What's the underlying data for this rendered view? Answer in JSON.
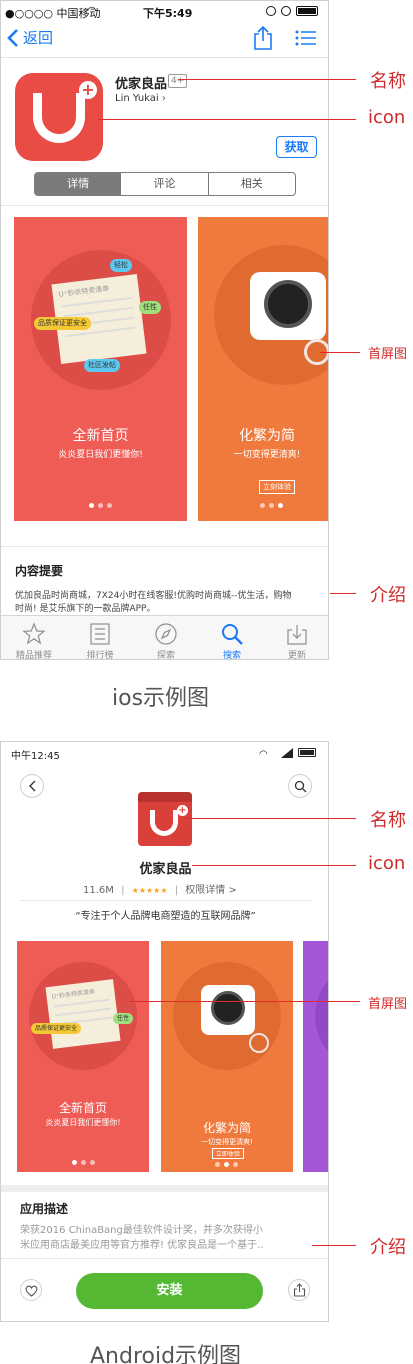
{
  "ios": {
    "status": {
      "carrier": "●○○○○ 中国移动",
      "time": "下午5:49"
    },
    "nav": {
      "back_label": "返回"
    },
    "app": {
      "name": "优家良品",
      "age_rating": "4+",
      "developer": "Lin Yukai",
      "get_label": "获取",
      "icon_letter": "U"
    },
    "segments": [
      "详情",
      "评论",
      "相关"
    ],
    "screenshots": [
      {
        "title": "全新首页",
        "subtitle": "炎炎夏日我们更懂你!",
        "paper_title": "U⁺秒杀特卖清单",
        "chips": [
          "轻松",
          "任性",
          "品质保证更安全",
          "社区发帖"
        ]
      },
      {
        "title": "化繁为简",
        "subtitle": "一切变得更清爽!",
        "button": "立刻体验"
      }
    ],
    "desc": {
      "heading": "内容提要",
      "text1": "优加良品时尚商城，7X24小时在线客服!优购时尚商城--优生活，购物",
      "text2": "时尚! 是艾乐旗下的一款品牌APP。"
    },
    "tabs": [
      {
        "label": "精品推荐",
        "icon": "star-icon"
      },
      {
        "label": "排行榜",
        "icon": "list-icon"
      },
      {
        "label": "探索",
        "icon": "compass-icon"
      },
      {
        "label": "搜索",
        "icon": "search-icon"
      },
      {
        "label": "更新",
        "icon": "download-icon"
      }
    ],
    "active_tab_index": 3
  },
  "android": {
    "status": {
      "time": "中午12:45"
    },
    "app": {
      "name": "优家良品",
      "size": "11.6M",
      "stars": "★★★★★",
      "permissions": "权限详情 >",
      "slogan": "“专注于个人品牌电商塑造的互联网品牌”",
      "icon_letter": "U"
    },
    "screenshots": [
      {
        "title": "全新首页",
        "subtitle": "炎炎夏日我们更懂你!",
        "paper_title": "U⁺秒杀特卖清单",
        "chips": [
          "任性",
          "品质保证更安全"
        ]
      },
      {
        "title": "化繁为简",
        "subtitle": "一切变得更清爽!",
        "button": "立即体验"
      }
    ],
    "desc": {
      "heading": "应用描述",
      "text1": "荣获2016 ChinaBang最佳软件设计奖，并多次获得小",
      "text2": "米应用商店最美应用等官方推荐! 优家良品是一个基于.."
    },
    "install_label": "安装"
  },
  "annotations": {
    "name": "名称",
    "icon": "icon",
    "screenshot": "首屏图",
    "intro": "介绍"
  },
  "captions": {
    "ios": "ios示例图",
    "android": "Android示例图"
  },
  "colors": {
    "ios_blue": "#1a7af8",
    "app_red": "#e94b45",
    "card_red": "#ee5c55",
    "card_orange": "#f07a3e",
    "card_purple": "#a356d8",
    "install_green": "#55b833",
    "annotation_red": "#e12b2b"
  }
}
